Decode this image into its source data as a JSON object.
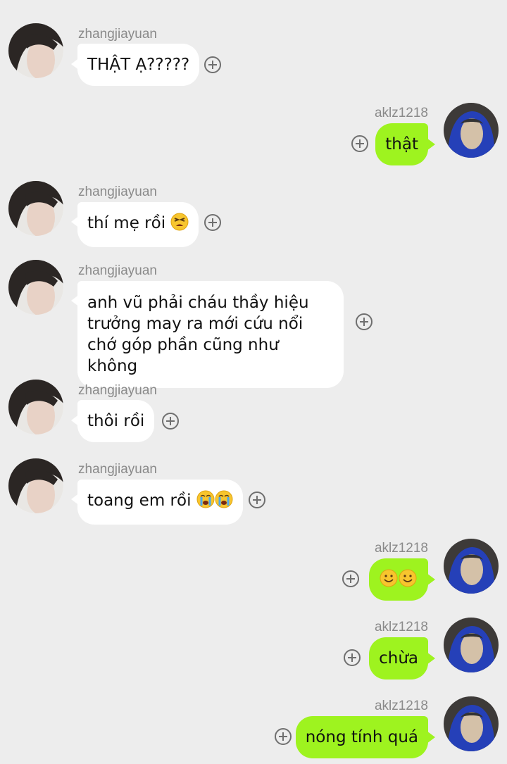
{
  "contacts": {
    "other": {
      "name": "zhangjiayuan",
      "avatar_icon": "portrait-avatar-icon"
    },
    "me": {
      "name": "aklz1218",
      "avatar_icon": "blue-hood-avatar-icon"
    }
  },
  "colors": {
    "background": "#ededed",
    "incoming_bubble": "#ffffff",
    "outgoing_bubble": "#9ef31f",
    "sender_name": "#8a8a8a"
  },
  "messages": [
    {
      "sender": "zhangjiayuan",
      "side": "left",
      "text": "THẬT Ạ?????"
    },
    {
      "sender": "aklz1218",
      "side": "right",
      "text": "thật"
    },
    {
      "sender": "zhangjiayuan",
      "side": "left",
      "text": "thí mẹ rồi",
      "emoji": "tired-face-emoji"
    },
    {
      "sender": "zhangjiayuan",
      "side": "left",
      "text": "anh vũ phải cháu thầy hiệu trưởng may ra mới cứu nổi chớ góp phần cũng như không"
    },
    {
      "sender": "zhangjiayuan",
      "side": "left",
      "text": "thôi rồi"
    },
    {
      "sender": "zhangjiayuan",
      "side": "left",
      "text": "toang em rồi",
      "emoji": "two-crying-faces-emoji"
    },
    {
      "sender": "aklz1218",
      "side": "right",
      "text": "",
      "emoji": "two-smiling-faces-emoji"
    },
    {
      "sender": "aklz1218",
      "side": "right",
      "text": "chừa"
    },
    {
      "sender": "aklz1218",
      "side": "right",
      "text": "nóng tính quá"
    }
  ],
  "action_icon": "add-circle-icon"
}
